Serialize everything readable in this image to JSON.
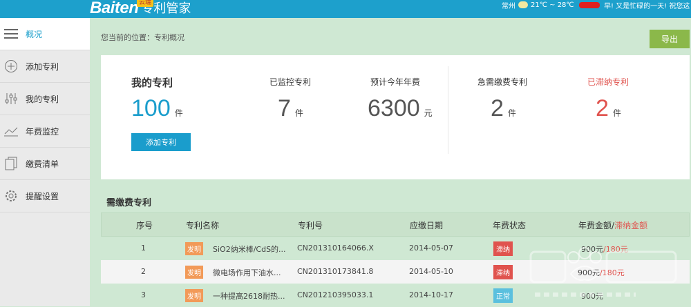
{
  "header": {
    "logo_en": "Baiten",
    "logo_cn": "专利管家",
    "badge": "云端",
    "city": "常州",
    "temperature": "21℃ ~ 28℃",
    "greeting": "早! 又是忙碌的一天! 祝您这"
  },
  "sidebar": {
    "items": [
      {
        "label": "概况",
        "icon": "menu-icon"
      },
      {
        "label": "添加专利",
        "icon": "plus-circle-icon"
      },
      {
        "label": "我的专利",
        "icon": "sliders-icon"
      },
      {
        "label": "年费监控",
        "icon": "line-chart-icon"
      },
      {
        "label": "缴费清单",
        "icon": "documents-icon"
      },
      {
        "label": "提醒设置",
        "icon": "gear-icon"
      }
    ]
  },
  "breadcrumb": "您当前的位置：专利概况",
  "export_label": "导出",
  "summary": {
    "title": "我的专利",
    "total": "100",
    "total_unit": "件",
    "add_label": "添加专利",
    "monitored_label": "已监控专利",
    "monitored": "7",
    "monitored_unit": "件",
    "annual_fee_label": "预计今年年费",
    "annual_fee": "6300",
    "annual_fee_unit": "元",
    "urgent_label": "急需缴费专利",
    "urgent": "2",
    "urgent_unit": "件",
    "overdue_label": "已滞纳专利",
    "overdue": "2",
    "overdue_unit": "件"
  },
  "section_title": "需缴费专利",
  "table": {
    "headers": {
      "index": "序号",
      "name": "专利名称",
      "number": "专利号",
      "due": "应缴日期",
      "status": "年费状态",
      "fee": "年费金额",
      "fee_sep": "/",
      "late_fee": "滞纳金额"
    },
    "rows": [
      {
        "index": "1",
        "type": "发明",
        "name": "SiO2纳米棒/CdS的...",
        "number": "CN201310164066.X",
        "due": "2014-05-07",
        "status": "滞纳",
        "fee": "900元",
        "late_fee": "/180元"
      },
      {
        "index": "2",
        "type": "发明",
        "name": "微电场作用下油水...",
        "number": "CN201310173841.8",
        "due": "2014-05-10",
        "status": "滞纳",
        "fee": "900元",
        "late_fee": "/180元"
      },
      {
        "index": "3",
        "type": "发明",
        "name": "一种提高2618耐热...",
        "number": "CN201210395033.1",
        "due": "2014-10-17",
        "status": "正常",
        "fee": "900元",
        "late_fee": ""
      }
    ]
  },
  "colors": {
    "topbar": "#1da0cc",
    "accent_green": "#8bb84a",
    "late_red": "#e0534e",
    "ok_blue": "#5bc0de"
  }
}
